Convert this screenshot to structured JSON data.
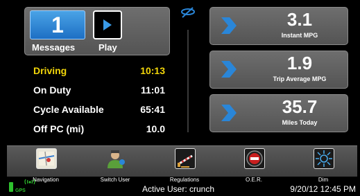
{
  "messages": {
    "count": "1",
    "label": "Messages"
  },
  "play": {
    "label": "Play"
  },
  "status": [
    {
      "label": "Driving",
      "value": "10:13",
      "highlight": true
    },
    {
      "label": "On Duty",
      "value": "11:01",
      "highlight": false
    },
    {
      "label": "Cycle Available",
      "value": "65:41",
      "highlight": false
    },
    {
      "label": "Off PC (mi)",
      "value": "10.0",
      "highlight": false
    }
  ],
  "metrics": [
    {
      "value": "3.1",
      "label": "Instant MPG"
    },
    {
      "value": "1.9",
      "label": "Trip Average MPG"
    },
    {
      "value": "35.7",
      "label": "Miles Today"
    }
  ],
  "toolbar": [
    {
      "label": "Navigation",
      "icon": "navigation-map-icon"
    },
    {
      "label": "Switch User",
      "icon": "switch-user-icon"
    },
    {
      "label": "Regulations",
      "icon": "regulations-icon"
    },
    {
      "label": "O.E.R.",
      "icon": "oer-record-icon"
    },
    {
      "label": "Dim",
      "icon": "dim-sun-icon"
    }
  ],
  "statusbar": {
    "gps": "GPS",
    "active_user": "Active User: crunch",
    "datetime": "9/20/12 12:45 PM"
  },
  "colors": {
    "accent_blue": "#2a86d8",
    "highlight_yellow": "#f2d60a",
    "panel_gray": "#616161"
  }
}
